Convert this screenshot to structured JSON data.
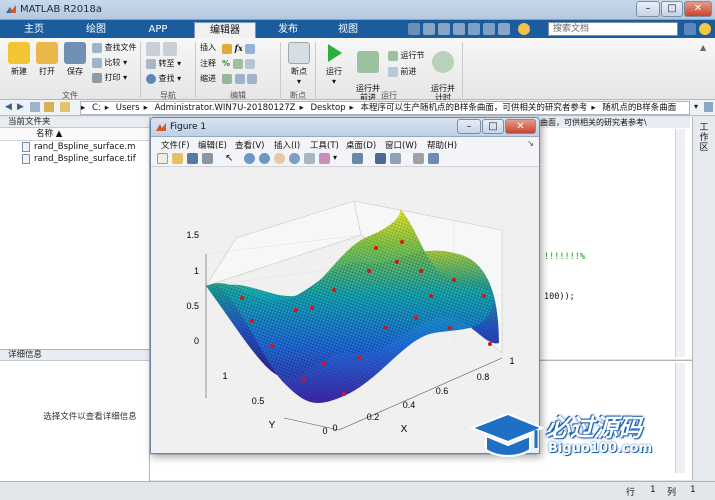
{
  "window": {
    "title": "MATLAB R2018a"
  },
  "tabs": [
    "主页",
    "绘图",
    "APP",
    "编辑器",
    "发布",
    "视图"
  ],
  "search": {
    "placeholder": "搜索文档"
  },
  "ribbon": {
    "file": {
      "new": "新建",
      "open": "打开",
      "save": "保存",
      "find_files": "查找文件",
      "compare": "比较",
      "print": "打印",
      "group": "文件"
    },
    "nav": {
      "goto": "转至",
      "find": "查找",
      "group": "导航"
    },
    "edit": {
      "insert": "插入",
      "comment": "注释",
      "indent": "缩进",
      "fx": "fx",
      "group": "编辑"
    },
    "breakpoints": {
      "label": "断点",
      "group": "断点"
    },
    "run": {
      "run": "运行",
      "run_advance": "运行并\n前进",
      "run_section": "运行节",
      "advance": "前进",
      "run_time": "运行并\n计时",
      "group": "运行"
    }
  },
  "address": {
    "segments": [
      "C:",
      "Users",
      "Administrator.WIN7U-20180127Z",
      "Desktop",
      "本程序可以生产随机点的B样条曲面，可供相关的研究者参考",
      "随机点的B样条曲面"
    ]
  },
  "current_folder": {
    "title": "当前文件夹",
    "column": "名称",
    "files": [
      "rand_Bspline_surface.m",
      "rand_Bspline_surface.tif"
    ]
  },
  "details": {
    "title": "详细信息",
    "message": "选择文件以查看详细信息"
  },
  "editor_bg": {
    "tab_text": "曲面，可供相关的研究者参考\\",
    "line1": "!!!!!!!%",
    "line2": "100));"
  },
  "workspace": {
    "label": "工作区"
  },
  "status": {
    "row_label": "行",
    "row": "1",
    "col_label": "列",
    "col": "1"
  },
  "figure": {
    "title": "Figure 1",
    "menu": [
      "文件(F)",
      "编辑(E)",
      "查看(V)",
      "插入(I)",
      "工具(T)",
      "桌面(D)",
      "窗口(W)",
      "帮助(H)"
    ]
  },
  "chart_data": {
    "type": "surface",
    "z_ticks": [
      "0",
      "0.5",
      "1",
      "1.5"
    ],
    "x_ticks": [
      "0",
      "0.2",
      "0.4",
      "0.6",
      "0.8",
      "1"
    ],
    "y_ticks": [
      "0",
      "0.5",
      "1"
    ],
    "xlabel": "X",
    "ylabel": "Y",
    "colormap": "parula",
    "points_color": "#e01010"
  },
  "watermark": {
    "text": "必过源码",
    "url": "Biguo100.com"
  }
}
